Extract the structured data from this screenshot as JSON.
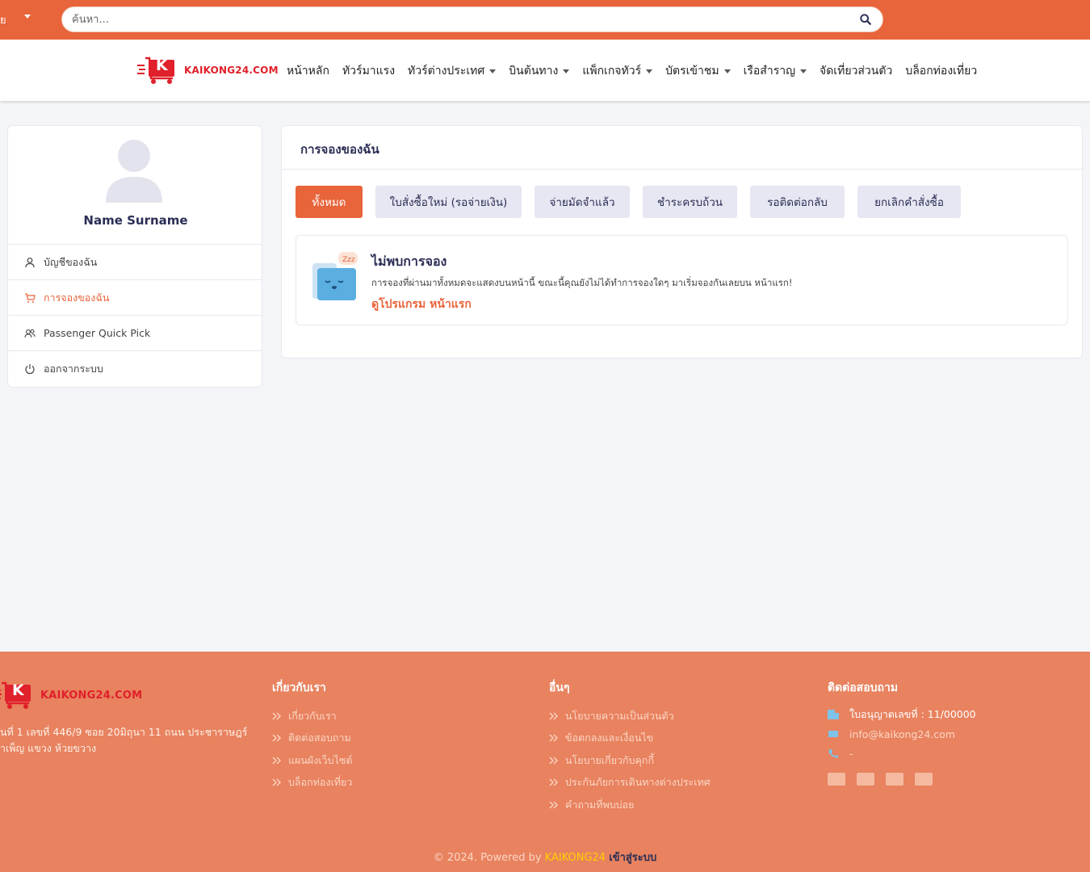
{
  "topbar": {
    "lang_label": "ย",
    "search_placeholder": "ค้นหา..."
  },
  "brand": {
    "logo_letter": "K",
    "name": "KAIKONG24.COM"
  },
  "nav": {
    "items": [
      {
        "label": "หน้าหลัก",
        "dropdown": false
      },
      {
        "label": "ทัวร์มาแรง",
        "dropdown": false
      },
      {
        "label": "ทัวร์ต่างประเทศ",
        "dropdown": true
      },
      {
        "label": "บินต้นทาง",
        "dropdown": true
      },
      {
        "label": "แพ็กเกจทัวร์",
        "dropdown": true
      },
      {
        "label": "บัตรเข้าชม",
        "dropdown": true
      },
      {
        "label": "เรือสำราญ",
        "dropdown": true
      },
      {
        "label": "จัดเที่ยวส่วนตัว",
        "dropdown": false
      },
      {
        "label": "บล็อกท่องเที่ยว",
        "dropdown": false
      }
    ]
  },
  "sidebar": {
    "user_name": "Name Surname",
    "items": [
      {
        "label": "บัญชีของฉัน",
        "icon": "user-icon",
        "active": false
      },
      {
        "label": "การจองของฉัน",
        "icon": "cart-icon",
        "active": true
      },
      {
        "label": "Passenger Quick Pick",
        "icon": "users-icon",
        "active": false
      },
      {
        "label": "ออกจากระบบ",
        "icon": "power-icon",
        "active": false
      }
    ]
  },
  "main": {
    "title": "การจองของฉัน",
    "tabs": [
      {
        "label": "ทั้งหมด",
        "active": true
      },
      {
        "label": "ใบสั่งซื้อใหม่ (รอจ่ายเงิน)",
        "active": false
      },
      {
        "label": "จ่ายมัดจำแล้ว",
        "active": false
      },
      {
        "label": "ชำระครบถ้วน",
        "active": false
      },
      {
        "label": "รอติดต่อกลับ",
        "active": false
      },
      {
        "label": "ยกเลิกคำสั่งซื้อ",
        "active": false
      }
    ],
    "empty": {
      "title": "ไม่พบการจอง",
      "description": "การจองที่ผ่านมาทั้งหมดจะแสดงบนหน้านี้ ขณะนี้คุณยังไม่ได้ทำการจองใดๆ มาเริ่มจองกันเลยบน หน้าแรก!",
      "link": "ดูโปรแกรม หน้าแรก",
      "zzz": "Zzz"
    }
  },
  "footer": {
    "address_line1": "นที่ 1 เลขที่ 446/9 ซอย 20มิถุนา 11 ถนน ประชาราษฎร์",
    "address_line2": "าเพ็ญ แขวง ห้วยขวาง",
    "about": {
      "heading": "เกี่ยวกับเรา",
      "links": [
        "เกี่ยวกับเรา",
        "ติดต่อสอบถาม",
        "แผนผังเว็บไซต์",
        "บล็อกท่องเที่ยว"
      ]
    },
    "others": {
      "heading": "อื่นๆ",
      "links": [
        "นโยบายความเป็นส่วนตัว",
        "ข้อตกลงและเงื่อนไข",
        "นโยบายเกี่ยวกับคุกกี้",
        "ประกันภัยการเดินทางต่างประเทศ",
        "คำถามที่พบบ่อย"
      ]
    },
    "contact": {
      "heading": "ติดต่อสอบถาม",
      "license": "ใบอนุญาตเลขที่ : 11/00000",
      "email": "info@kaikong24.com",
      "phone": "-"
    },
    "payment_icons": [
      "card-icon",
      "visa-icon",
      "mastercard-icon",
      "paypal-icon"
    ],
    "copyright_prefix": "© 2024. Powered by",
    "copyright_brand": "KAIKONG24",
    "login_label": "เข้าสู่ระบบ"
  },
  "colors": {
    "accent": "#e8643a",
    "footer_bg": "#e8825f",
    "navy": "#2b2e55",
    "tab_bg": "#e6e7f2"
  }
}
